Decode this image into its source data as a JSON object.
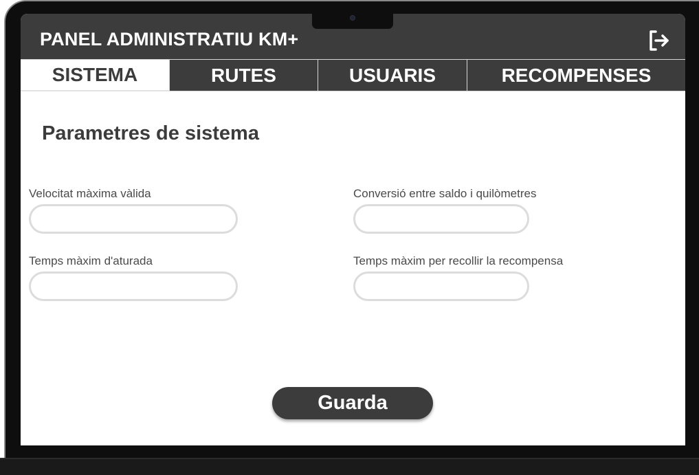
{
  "header": {
    "title": "PANEL ADMINISTRATIU KM+",
    "logout_icon": "logout-icon"
  },
  "tabs": [
    {
      "label": "SISTEMA",
      "active": true
    },
    {
      "label": "RUTES",
      "active": false
    },
    {
      "label": "USUARIS",
      "active": false
    },
    {
      "label": "RECOMPENSES",
      "active": false
    }
  ],
  "main": {
    "title": "Parametres de sistema",
    "fields": [
      {
        "label": "Velocitat màxima vàlida",
        "value": ""
      },
      {
        "label": "Conversió entre saldo i quilòmetres",
        "value": ""
      },
      {
        "label": "Temps màxim d'aturada",
        "value": ""
      },
      {
        "label": "Temps màxim per recollir la recompensa",
        "value": ""
      }
    ],
    "save_label": "Guarda"
  },
  "colors": {
    "header_bg": "#3c3c3c",
    "tab_active_bg": "#ffffff",
    "input_border": "#dcdcdc",
    "button_bg": "#3c3c3c"
  }
}
